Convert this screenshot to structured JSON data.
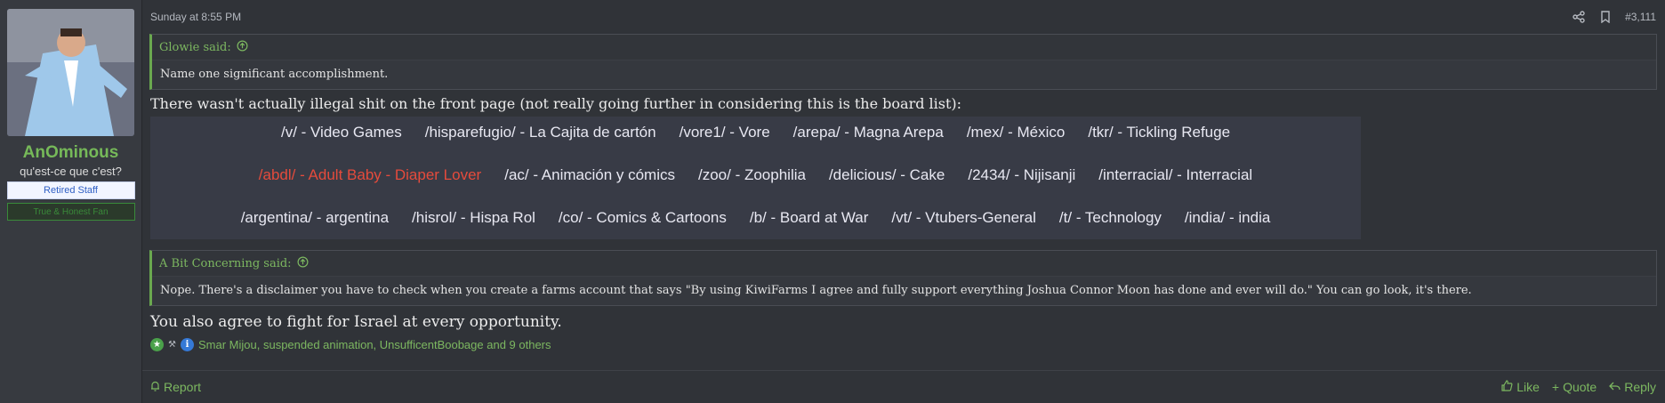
{
  "user": {
    "name": "AnOminous",
    "title": "qu'est-ce que c'est?",
    "banners": [
      "Retired Staff",
      "True & Honest Fan"
    ]
  },
  "post": {
    "timestamp": "Sunday at 8:55 PM",
    "number": "#3,111",
    "quote1": {
      "author": "Glowie said:",
      "text": "Name one significant accomplishment."
    },
    "text1": "There wasn't actually illegal shit on the front page (not really going further in considering this is the board list):",
    "boards": [
      [
        "/v/ - Video Games",
        "/hisparefugio/ - La Cajita de cartón",
        "/vore1/ - Vore",
        "/arepa/ - Magna Arepa",
        "/mex/ - México",
        "/tkr/ - Tickling Refuge"
      ],
      [
        "/abdl/ - Adult Baby - Diaper Lover",
        "/ac/ - Animación y cómics",
        "/zoo/ - Zoophilia",
        "/delicious/ - Cake",
        "/2434/ - Nijisanji",
        "/interracial/ - Interracial"
      ],
      [
        "/argentina/ - argentina",
        "/hisrol/ - Hispa Rol",
        "/co/ - Comics & Cartoons",
        "/b/ - Board at War",
        "/vt/ - Vtubers-General",
        "/t/ - Technology",
        "/india/ - india"
      ]
    ],
    "quote2": {
      "author": "A Bit Concerning said:",
      "text": "Nope. There's a disclaimer you have to check when you create a farms account that says \"By using KiwiFarms I agree and fully support everything Joshua Connor Moon has done and ever will do.\" You can go look, it's there."
    },
    "text2": "You also agree to fight for Israel at every opportunity.",
    "reactions": {
      "icons": [
        "star-icon",
        "tools-icon",
        "info-icon"
      ],
      "names": "Smar Mijou, suspended animation, UnsufficentBoobage and 9 others"
    }
  },
  "footer": {
    "report": "Report",
    "like": "Like",
    "quote": "Quote",
    "reply": "Reply"
  },
  "colors": {
    "accent": "#7cb760",
    "highlight": "#e54b3c",
    "background": "#2b2d31"
  }
}
